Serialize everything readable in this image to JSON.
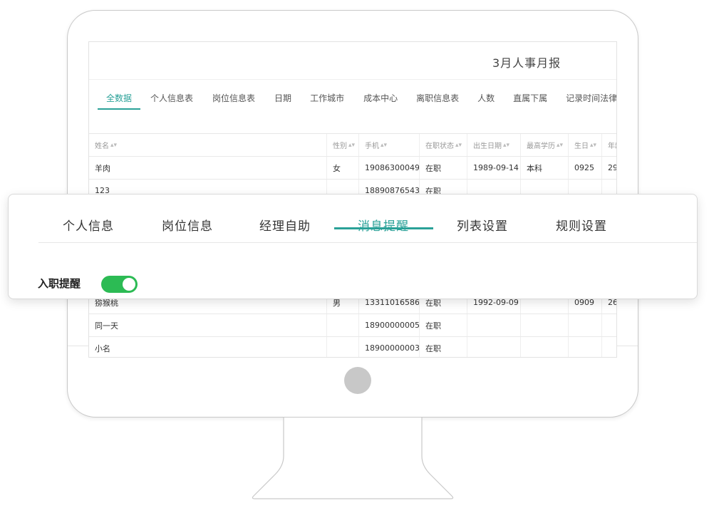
{
  "report": {
    "title": "3月人事月报",
    "tabs": [
      "全数据",
      "个人信息表",
      "岗位信息表",
      "日期",
      "工作城市",
      "成本中心",
      "离职信息表",
      "人数",
      "直属下属",
      "记录时间法律"
    ],
    "active_tab": "全数据"
  },
  "table": {
    "columns": [
      "姓名",
      "性别",
      "手机",
      "在职状态",
      "出生日期",
      "最高学历",
      "生日",
      "年龄"
    ],
    "rows_top": [
      [
        "羊肉",
        "女",
        "19086300049",
        "在职",
        "1989-09-14",
        "本科",
        "0925",
        "29"
      ],
      [
        "123",
        "",
        "18890876543",
        "在职",
        "",
        "",
        "",
        ""
      ]
    ],
    "rows_bottom": [
      [
        "猕猴桃",
        "男",
        "13311016586",
        "在职",
        "1992-09-09",
        "",
        "0909",
        "26"
      ],
      [
        "同一天",
        "",
        "18900000005",
        "在职",
        "",
        "",
        "",
        ""
      ],
      [
        "小名",
        "",
        "18900000003",
        "在职",
        "",
        "",
        "",
        ""
      ]
    ]
  },
  "settings": {
    "tabs": [
      "个人信息",
      "岗位信息",
      "经理自助",
      "消息提醒",
      "列表设置",
      "规则设置"
    ],
    "active_tab": "消息提醒",
    "onboarding_reminder_label": "入职提醒",
    "onboarding_reminder_on": true
  },
  "colors": {
    "accent": "#2aa198",
    "toggle_on": "#2cbb54"
  },
  "icons": [
    "sort-icon",
    "toggle-switch"
  ]
}
